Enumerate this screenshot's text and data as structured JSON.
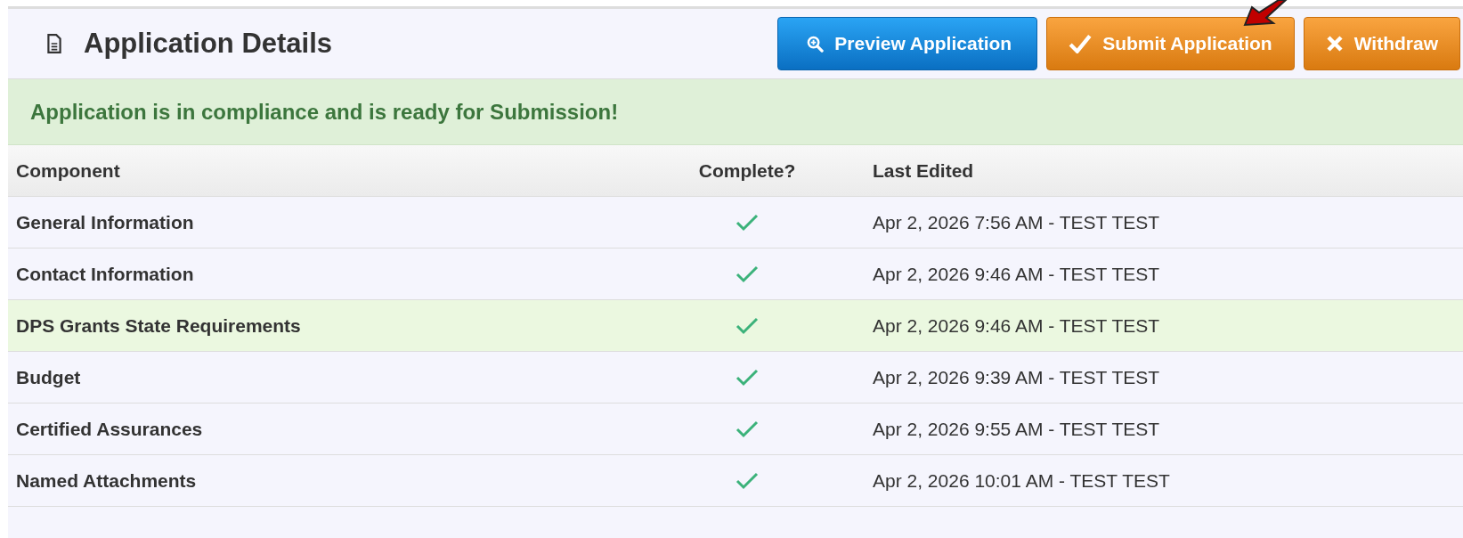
{
  "header": {
    "title": "Application Details"
  },
  "buttons": [
    {
      "label": "Preview Application",
      "kind": "preview"
    },
    {
      "label": "Submit Application",
      "kind": "submit"
    },
    {
      "label": "Withdraw",
      "kind": "withdraw"
    }
  ],
  "alert": {
    "message": "Application is in compliance and is ready for Submission!"
  },
  "table": {
    "columns": [
      "Component",
      "Complete?",
      "Last Edited"
    ],
    "rows": [
      {
        "component": "General Information",
        "complete": true,
        "last_edited": "Apr 2, 2026 7:56 AM - TEST TEST",
        "highlighted": false
      },
      {
        "component": "Contact Information",
        "complete": true,
        "last_edited": "Apr 2, 2026 9:46 AM - TEST TEST",
        "highlighted": false
      },
      {
        "component": "DPS Grants State Requirements",
        "complete": true,
        "last_edited": "Apr 2, 2026 9:46 AM - TEST TEST",
        "highlighted": true
      },
      {
        "component": "Budget",
        "complete": true,
        "last_edited": "Apr 2, 2026 9:39 AM - TEST TEST",
        "highlighted": false
      },
      {
        "component": "Certified Assurances",
        "complete": true,
        "last_edited": "Apr 2, 2026 9:55 AM - TEST TEST",
        "highlighted": false
      },
      {
        "component": "Named Attachments",
        "complete": true,
        "last_edited": "Apr 2, 2026 10:01 AM - TEST TEST",
        "highlighted": false
      }
    ]
  }
}
